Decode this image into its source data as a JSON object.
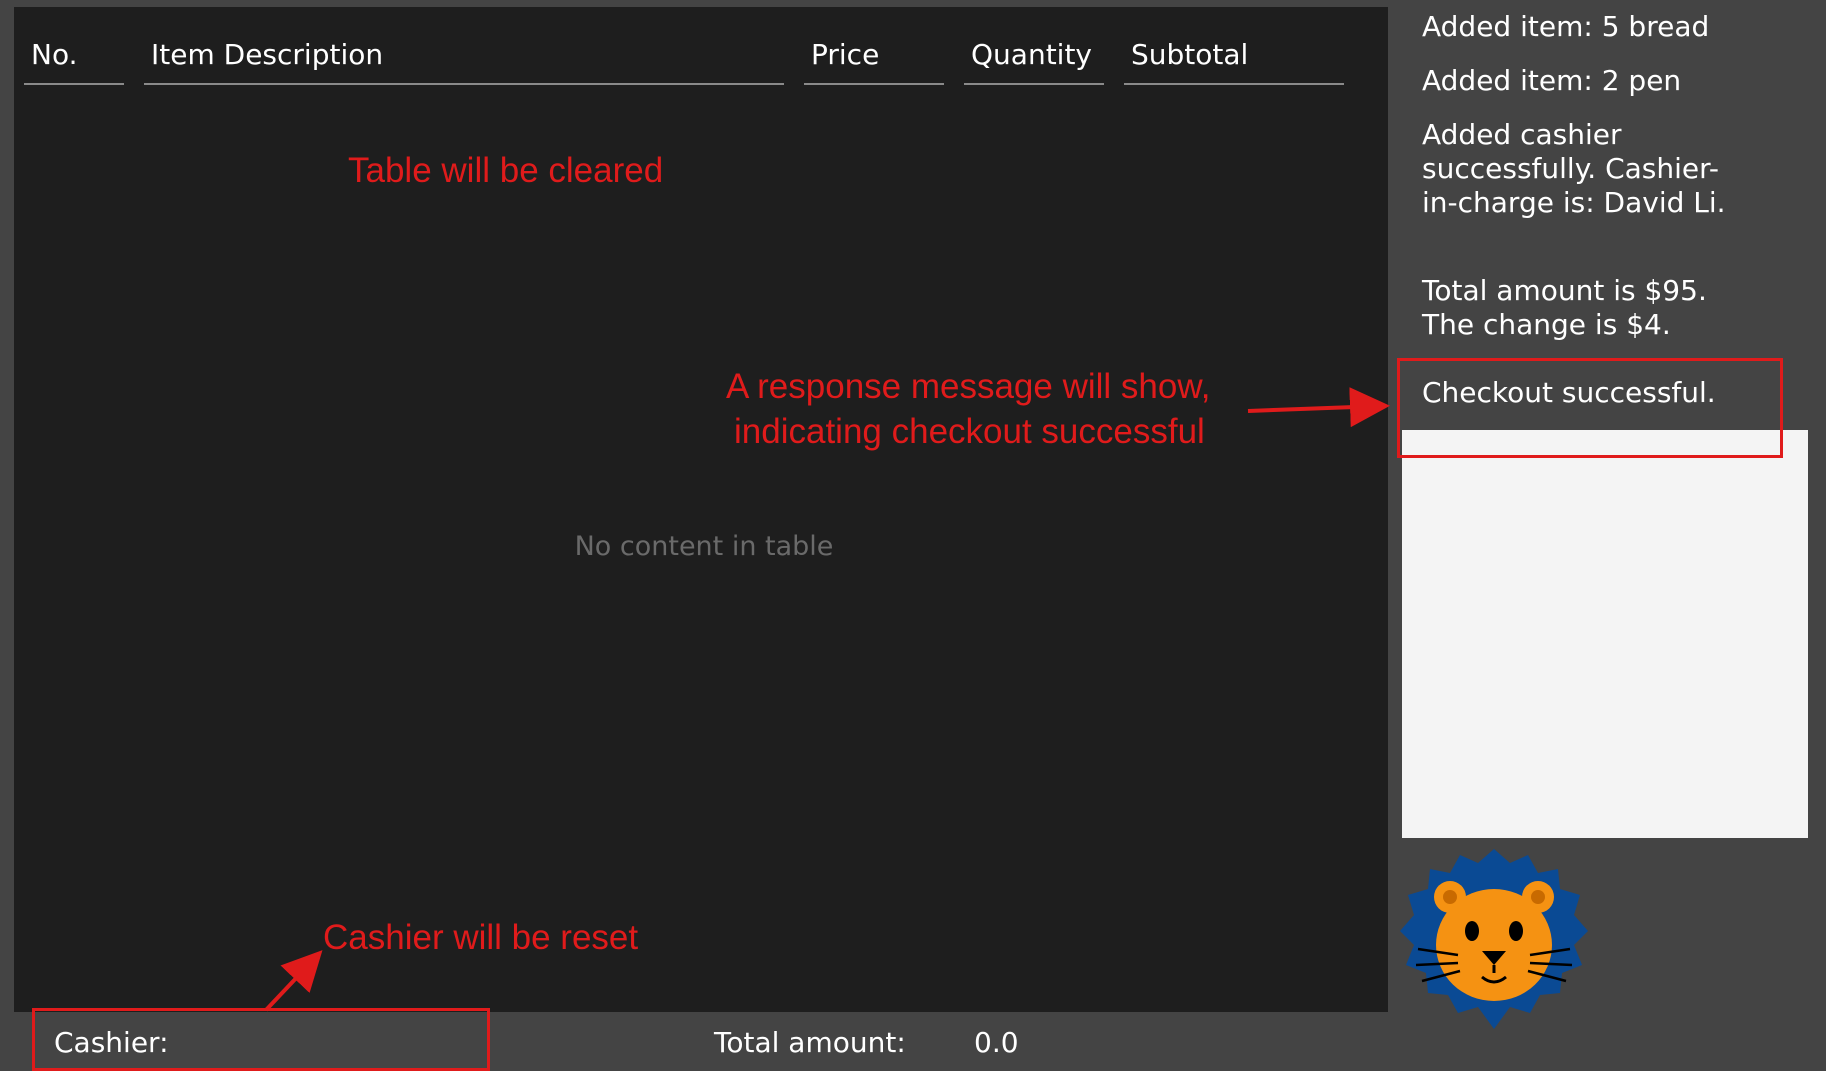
{
  "table": {
    "columns": [
      "No.",
      "Item Description",
      "Price",
      "Quantity",
      "Subtotal"
    ],
    "empty_text": "No content in table"
  },
  "log": {
    "messages": [
      "Added item: 5 bread",
      "Added item: 2 pen",
      "Added cashier successfully. Cashier-in-charge is: David Li.",
      "Total amount is $95. The change is $4.",
      "Checkout successful."
    ]
  },
  "footer": {
    "cashier_label": "Cashier:",
    "total_label": "Total amount:",
    "total_value": "0.0"
  },
  "annotations": {
    "table_cleared": "Table will be cleared",
    "response_line1": "A response message will show,",
    "response_line2": "indicating checkout successful",
    "cashier_reset": "Cashier will be reset"
  },
  "colors": {
    "annotation": "#e01b1b",
    "mascot_mane": "#0a4a94",
    "mascot_face": "#f59212"
  },
  "icons": {
    "mascot": "lion-mascot-icon"
  }
}
